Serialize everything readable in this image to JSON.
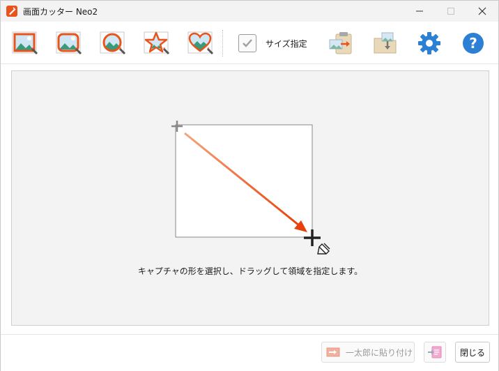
{
  "window": {
    "title": "画面カッター Neo2"
  },
  "toolbar": {
    "tools": [
      {
        "name": "rectangle-capture",
        "icon": "rectangle-capture-icon"
      },
      {
        "name": "rounded-rectangle-capture",
        "icon": "rounded-rectangle-capture-icon"
      },
      {
        "name": "ellipse-capture",
        "icon": "ellipse-capture-icon"
      },
      {
        "name": "star-capture",
        "icon": "star-capture-icon"
      },
      {
        "name": "heart-capture",
        "icon": "heart-capture-icon"
      }
    ],
    "size_checkbox_checked": true,
    "size_label": "サイズ指定",
    "paste_clipboard_icon": "clipboard-paste-icon",
    "save_folder_icon": "folder-save-icon",
    "settings_icon": "gear-icon",
    "help_icon": "help-icon",
    "help_glyph": "?"
  },
  "main": {
    "instruction": "キャプチャの形を選択し、ドラッグして領域を指定します。"
  },
  "footer": {
    "paste_button_label": "一太郎に貼り付け",
    "close_button_label": "閉じる"
  },
  "colors": {
    "accent_orange": "#e8541c",
    "accent_blue": "#2b7fd4",
    "background": "#f3f3f3"
  }
}
